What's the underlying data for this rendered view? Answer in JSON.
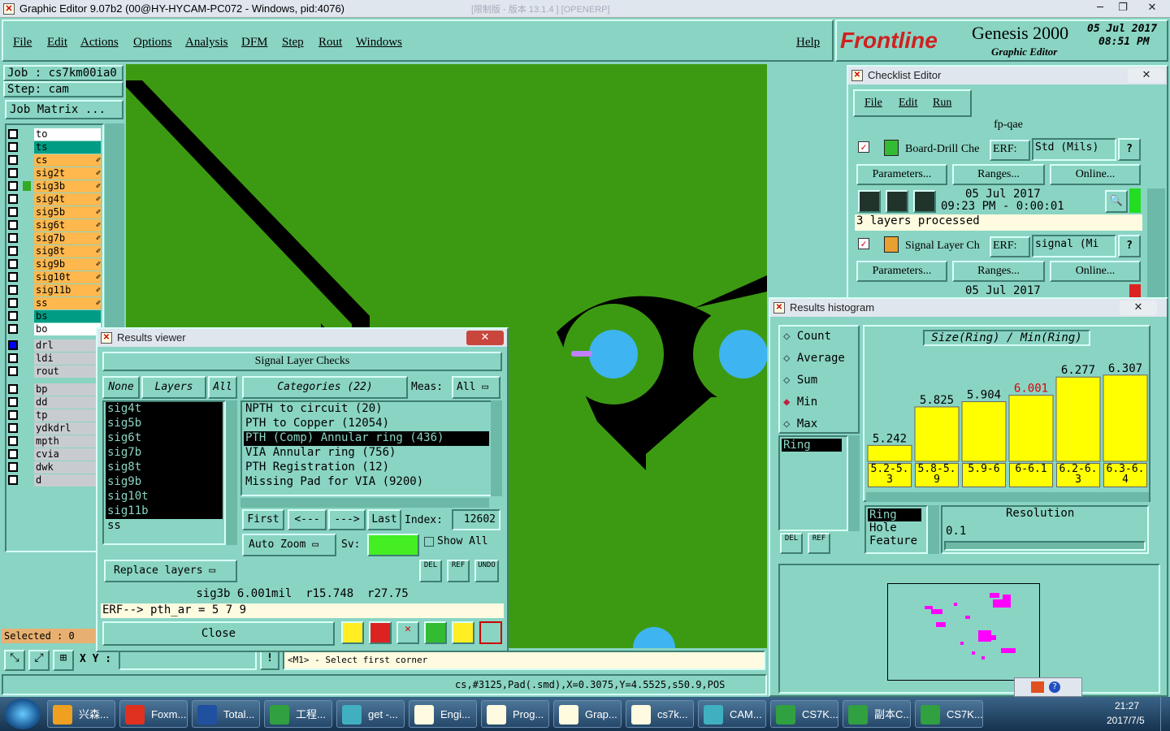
{
  "window": {
    "title": "Graphic Editor 9.07b2 (00@HY-HYCAM-PC072 - Windows, pid:4076)",
    "faded_title": "[限制版 - 版本 13.1.4 ] [OPENERP]"
  },
  "menu": [
    "File",
    "Edit",
    "Actions",
    "Options",
    "Analysis",
    "DFM",
    "Step",
    "Rout",
    "Windows"
  ],
  "help": "Help",
  "brand": {
    "logo": "Frontline",
    "product": "Genesis 2000",
    "sub": "Graphic Editor",
    "date": "05 Jul 2017",
    "time": "08:51 PM"
  },
  "job": {
    "job": "Job : cs7km00ia0",
    "step": "Step: cam",
    "matrix": "Job Matrix ..."
  },
  "layers_top": [
    {
      "name": "to",
      "color": "#ffffff"
    },
    {
      "name": "ts",
      "color": "#009c84"
    },
    {
      "name": "cs",
      "color": "#ffb84e"
    },
    {
      "name": "sig2t",
      "color": "#ffb84e"
    },
    {
      "name": "sig3b",
      "color": "#ffb84e"
    },
    {
      "name": "sig4t",
      "color": "#ffb84e"
    },
    {
      "name": "sig5b",
      "color": "#ffb84e"
    },
    {
      "name": "sig6t",
      "color": "#ffb84e"
    },
    {
      "name": "sig7b",
      "color": "#ffb84e"
    },
    {
      "name": "sig8t",
      "color": "#ffb84e"
    },
    {
      "name": "sig9b",
      "color": "#ffb84e"
    },
    {
      "name": "sig10t",
      "color": "#ffb84e"
    },
    {
      "name": "sig11b",
      "color": "#ffb84e"
    },
    {
      "name": "ss",
      "color": "#ffb84e"
    },
    {
      "name": "bs",
      "color": "#009c84"
    },
    {
      "name": "bo",
      "color": "#ffffff"
    }
  ],
  "layers_drill": [
    {
      "name": "drl"
    },
    {
      "name": "ldi"
    },
    {
      "name": "rout"
    }
  ],
  "layers_misc": [
    {
      "name": "bp"
    },
    {
      "name": "dd"
    },
    {
      "name": "tp"
    },
    {
      "name": "ydkdrl"
    },
    {
      "name": "mpth"
    },
    {
      "name": "cvia"
    },
    {
      "name": "dwk"
    },
    {
      "name": "d"
    }
  ],
  "selected": "Selected : 0",
  "coords_label": "X Y :",
  "prompt": "<M1> - Select first corner",
  "status_line": "cs,#3125,Pad(.smd),X=0.3075,Y=4.5525,s50.9,POS",
  "results_viewer": {
    "title": "Results viewer",
    "header": "Signal Layer Checks",
    "none": "None",
    "layers": "Layers",
    "all": "All",
    "categories": "Categories (22)",
    "meas": "Meas:",
    "meas_val": "All",
    "layer_list": [
      "sig4t",
      "sig5b",
      "sig6t",
      "sig7b",
      "sig8t",
      "sig9b",
      "sig10t",
      "sig11b",
      "ss"
    ],
    "category_list": [
      "NPTH to circuit (20)",
      "PTH to Copper (12054)",
      "PTH (Comp) Annular ring (436)",
      "VIA Annular ring (756)",
      "PTH Registration (12)",
      "Missing Pad for VIA (9200)"
    ],
    "selected_category": 2,
    "nav": {
      "first": "First",
      "prev": "<---",
      "next": "--->",
      "last": "Last",
      "index_label": "Index:",
      "index": "12602"
    },
    "auto_zoom": "Auto Zoom",
    "sv": "Sv:",
    "show_all": "Show All",
    "replace": "Replace layers",
    "result_line": "sig3b 6.001mil  r15.748  r27.75",
    "erf_line": "ERF--> pth_ar = 5 7 9",
    "close": "Close",
    "del": "DEL",
    "ref": "REF",
    "undo": "UNDO"
  },
  "checklist": {
    "title": "Checklist Editor",
    "menu": [
      "File",
      "Edit",
      "Run"
    ],
    "name": "fp-qae",
    "actions": [
      {
        "name": "Board-Drill Che",
        "erf": "ERF:",
        "param": "Std (Mils)",
        "date": "05 Jul 2017",
        "time": "09:23 PM - 0:00:01",
        "status": "3 layers processed",
        "status_color": "#22dd22"
      },
      {
        "name": "Signal Layer Ch",
        "erf": "ERF:",
        "param": "signal (Mi",
        "date": "05 Jul 2017",
        "status_color": "#dd2222"
      }
    ],
    "buttons": [
      "Parameters...",
      "Ranges...",
      "Online..."
    ]
  },
  "histogram": {
    "title": "Results histogram",
    "modes": [
      "Count",
      "Average",
      "Sum",
      "Min",
      "Max"
    ],
    "mode_selected": "Min",
    "heading": "Size(Ring) / Min(Ring)",
    "bins": [
      "5.2-5.3",
      "5.8-5.9",
      "5.9-6",
      "6-6.1",
      "6.2-6.3",
      "6.3-6.4"
    ],
    "values": [
      5.242,
      5.825,
      5.904,
      6.001,
      6.277,
      6.307
    ],
    "value_labels": [
      "5.242",
      "5.825",
      "5.904",
      "6.001",
      "6.277",
      "6.307"
    ],
    "highlight_index": 3,
    "highlight_color": "#e00000",
    "list": [
      "Ring"
    ],
    "sizes": [
      "Ring",
      "Hole",
      "Feature"
    ],
    "resolution_label": "Resolution",
    "resolution": "0.1",
    "del": "DEL",
    "ref": "REF"
  },
  "taskbar": {
    "items": [
      "兴森...",
      "Foxm...",
      "Total...",
      "工程...",
      "get -...",
      "Engi...",
      "Prog...",
      "Grap...",
      "cs7k...",
      "CAM...",
      "CS7K...",
      "副本C...",
      "CS7K..."
    ],
    "time": "21:27",
    "date": "2017/7/5"
  }
}
